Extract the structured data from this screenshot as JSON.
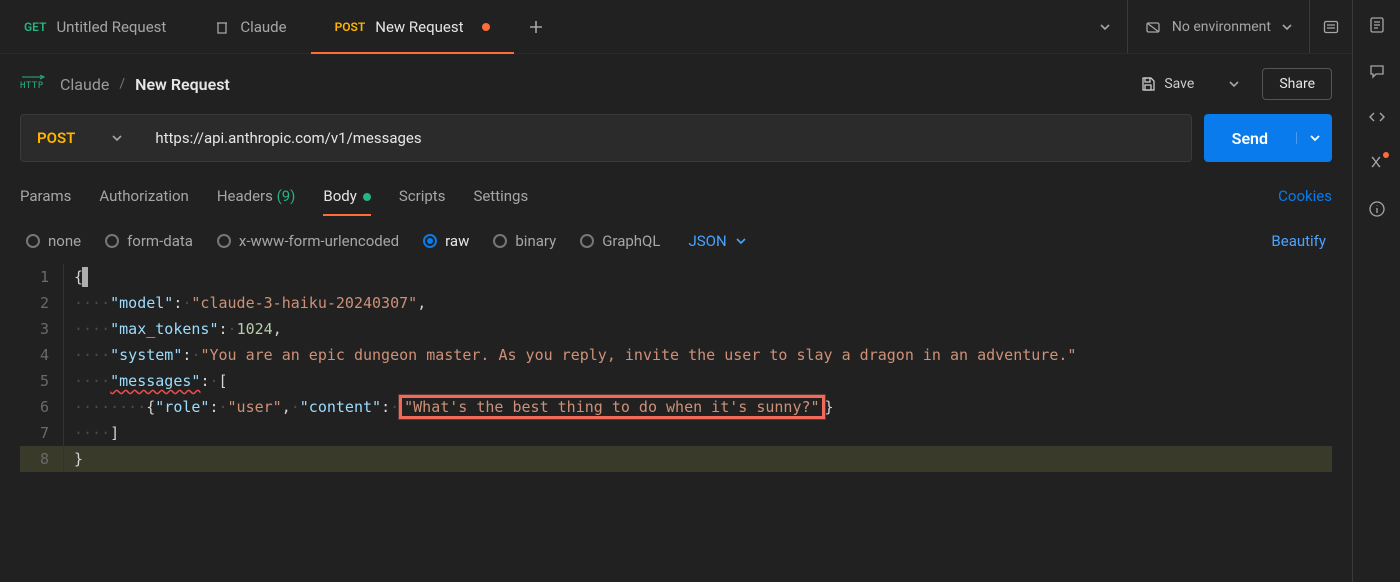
{
  "tabs": [
    {
      "method": "GET",
      "title": "Untitled Request",
      "active": false,
      "dirty": false
    },
    {
      "method": "",
      "title": "Claude",
      "active": false,
      "dirty": false,
      "icon": "collection"
    },
    {
      "method": "POST",
      "title": "New Request",
      "active": true,
      "dirty": true
    }
  ],
  "environment": {
    "label": "No environment"
  },
  "breadcrumb": {
    "http_label": "HTTP",
    "parent": "Claude",
    "current": "New Request"
  },
  "actions": {
    "save": "Save",
    "share": "Share"
  },
  "request": {
    "method": "POST",
    "url": "https://api.anthropic.com/v1/messages",
    "send": "Send"
  },
  "req_tabs": {
    "params": "Params",
    "auth": "Authorization",
    "headers": "Headers",
    "headers_count": "(9)",
    "body": "Body",
    "scripts": "Scripts",
    "settings": "Settings",
    "cookies": "Cookies"
  },
  "body_types": {
    "none": "none",
    "form_data": "form-data",
    "urlencoded": "x-www-form-urlencoded",
    "raw": "raw",
    "binary": "binary",
    "graphql": "GraphQL",
    "json": "JSON",
    "beautify": "Beautify"
  },
  "editor": {
    "k_model": "\"model\"",
    "v_model": "\"claude-3-haiku-20240307\"",
    "k_maxtokens": "\"max_tokens\"",
    "v_maxtokens": "1024",
    "k_system": "\"system\"",
    "v_system": "\"You are an epic dungeon master. As you reply, invite the user to slay a dragon in an adventure.\"",
    "k_messages": "\"messages\"",
    "k_role": "\"role\"",
    "v_role": "\"user\"",
    "k_content": "\"content\"",
    "v_content": "\"What's the best thing to do when it's sunny?\"",
    "ln1": "1",
    "ln2": "2",
    "ln3": "3",
    "ln4": "4",
    "ln5": "5",
    "ln6": "6",
    "ln7": "7",
    "ln8": "8"
  }
}
